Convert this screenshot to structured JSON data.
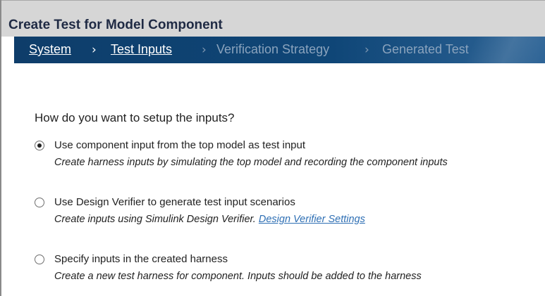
{
  "dialog": {
    "title": "Create Test for Model Component"
  },
  "breadcrumb": {
    "items": [
      {
        "label": "System",
        "state": "completed"
      },
      {
        "label": "Test Inputs",
        "state": "current"
      },
      {
        "label": "Verification Strategy",
        "state": "pending"
      },
      {
        "label": "Generated Test",
        "state": "pending"
      }
    ],
    "separator": "›"
  },
  "question": "How do you want to setup the inputs?",
  "options": [
    {
      "label": "Use component input from the top model as test input",
      "description": "Create harness inputs by simulating the top model and recording the component inputs",
      "selected": true
    },
    {
      "label": "Use Design Verifier to generate test input scenarios",
      "description": "Create inputs using Simulink Design Verifier.",
      "link": "Design Verifier Settings",
      "selected": false
    },
    {
      "label": "Specify inputs in the created harness",
      "description": "Create a new test harness for component. Inputs should be added to the harness",
      "selected": false
    }
  ],
  "colors": {
    "breadcrumb_bg": "#0f4677",
    "title_bar_bg": "#d6d6d6",
    "link": "#2e6fb4",
    "pending_step": "#8aa3bd"
  }
}
